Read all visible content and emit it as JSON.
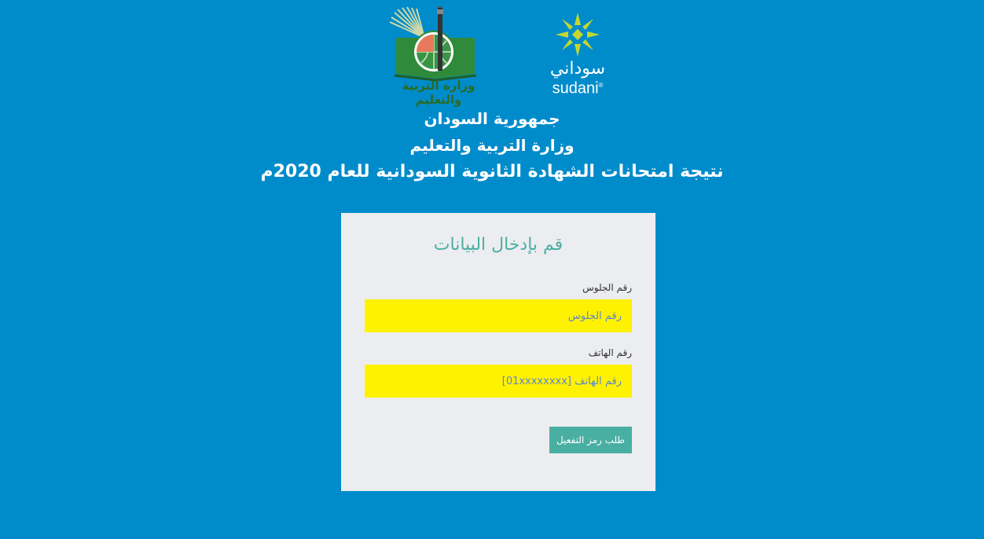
{
  "logos": {
    "ministry_logo_text": "وزارة التربية والتعليم",
    "sudani_arabic": "سوداني",
    "sudani_english": "sudani",
    "sudani_registered": "®"
  },
  "header": {
    "line1": "جمهورية السودان",
    "line2": "وزارة التربية والتعليم",
    "line3": "نتيجة امتحانات الشهادة الثانوية السودانية للعام 2020م"
  },
  "form": {
    "heading": "قم بإدخال البيانات",
    "seat_label": "رقم الجلوس",
    "seat_placeholder": "رقم الجلوس",
    "seat_value": "",
    "phone_label": "رقم الهاتف",
    "phone_placeholder": "رقم الهاتف [01xxxxxxxx]",
    "phone_value": "",
    "submit_label": "طلب رمز التفعيل"
  },
  "colors": {
    "background": "#008ccb",
    "card": "#ecedf0",
    "accent": "#4aafa3",
    "input_bg": "#fff200"
  }
}
